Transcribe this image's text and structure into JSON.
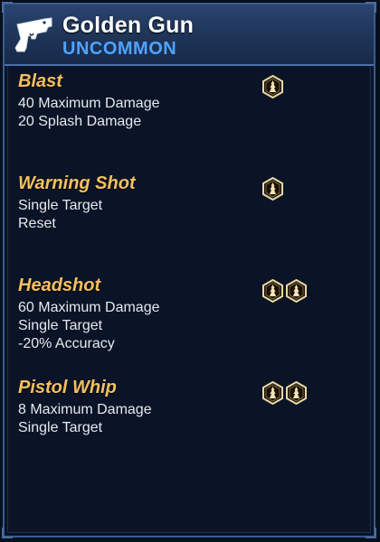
{
  "item": {
    "name": "Golden Gun",
    "rarity": "UNCOMMON",
    "icon": "pistol-icon"
  },
  "colors": {
    "rarity": "#4fa3ff",
    "ability_name": "#f4c060",
    "header_bg": "#1d3356",
    "panel_bg": "#0a1426"
  },
  "abilities": [
    {
      "name": "Blast",
      "lines": [
        "40 Maximum Damage",
        "20 Splash Damage"
      ],
      "action_points": 1
    },
    {
      "name": "Warning Shot",
      "lines": [
        "Single Target",
        "Reset"
      ],
      "action_points": 1
    },
    {
      "name": "Headshot",
      "lines": [
        "60 Maximum Damage",
        "Single Target",
        "-20% Accuracy"
      ],
      "action_points": 2
    },
    {
      "name": "Pistol Whip",
      "lines": [
        "8 Maximum Damage",
        "Single Target"
      ],
      "action_points": 2
    }
  ]
}
